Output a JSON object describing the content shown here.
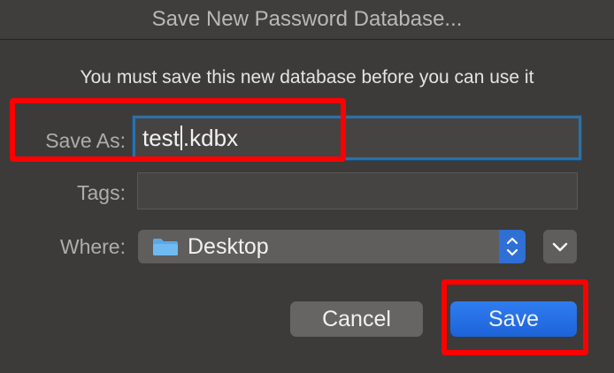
{
  "window": {
    "title": "Save New Password Database..."
  },
  "message": "You must save this new database before you can use it",
  "fields": {
    "save_as_label": "Save As:",
    "save_as_value_before_caret": "test",
    "save_as_value_after_caret": ".kdbx",
    "tags_label": "Tags:",
    "tags_value": "",
    "where_label": "Where:",
    "where_value": "Desktop"
  },
  "buttons": {
    "cancel": "Cancel",
    "save": "Save"
  },
  "annotations": {
    "highlight_color": "#ff0000"
  },
  "icons": {
    "location_icon": "folder-icon",
    "stepper_icon": "up-down-chevron-icon",
    "expand_icon": "chevron-down-icon"
  },
  "colors": {
    "dialog_bg": "#3c3b39",
    "accent_blue": "#2f6fd6",
    "focus_ring": "#2f6fa5"
  }
}
